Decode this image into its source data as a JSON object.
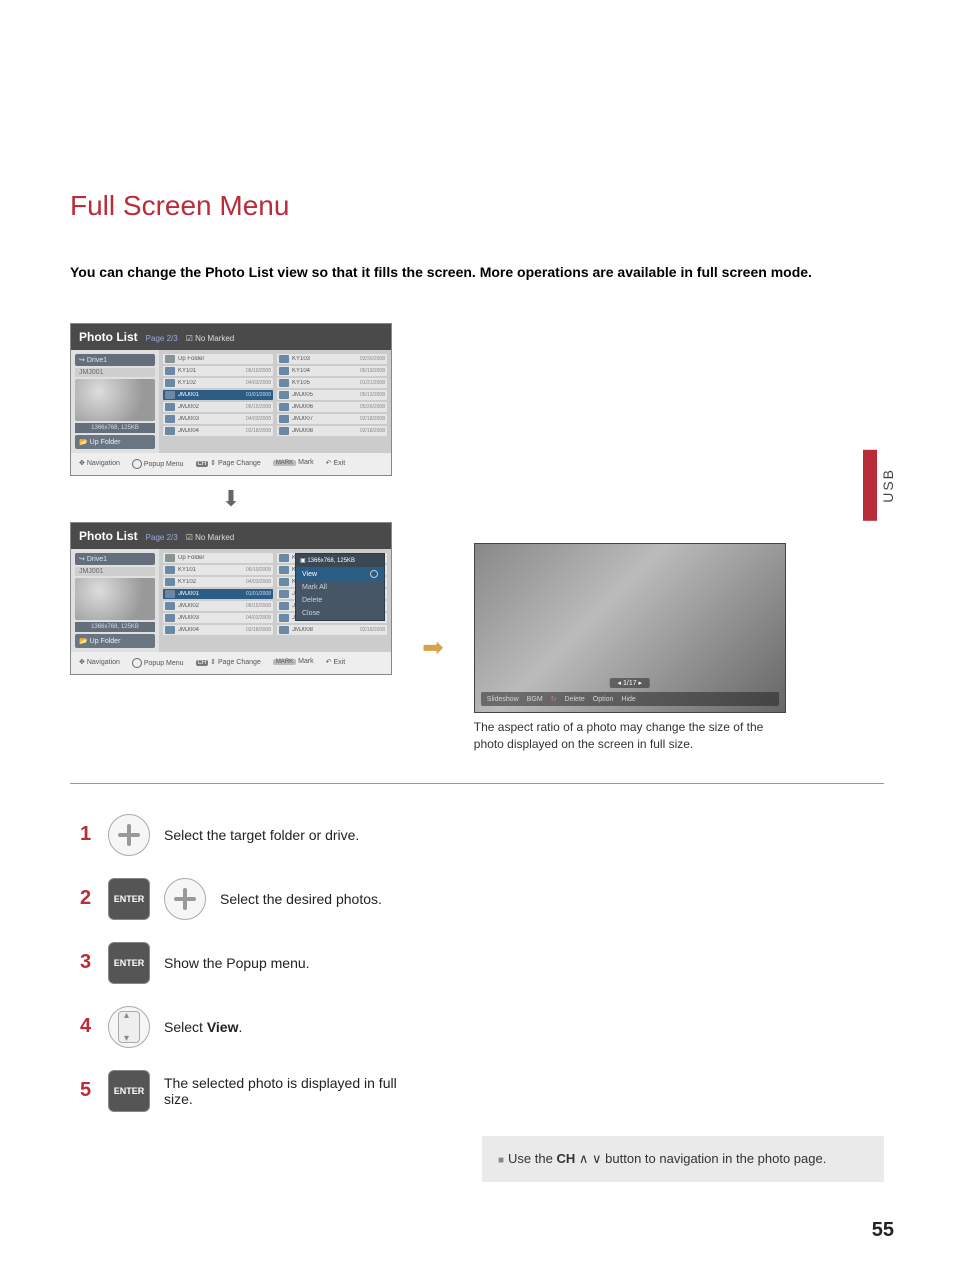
{
  "page": {
    "title": "Full Screen Menu",
    "intro": "You can change the Photo List view so that it fills the screen. More operations are available in full screen mode.",
    "side_tab": "USB",
    "page_number": "55"
  },
  "screen1": {
    "header_title": "Photo List",
    "header_page": "Page 2/3",
    "header_marked": "No Marked",
    "drive": "Drive1",
    "selected_name": "JMJ001",
    "selected_size": "1366x768, 125KB",
    "up_folder": "Up Folder",
    "col1": [
      {
        "name": "Up Folder",
        "date": "",
        "folder": true
      },
      {
        "name": "KY101",
        "date": "06/10/2008"
      },
      {
        "name": "KY102",
        "date": "04/03/2008"
      },
      {
        "name": "JMJ001",
        "date": "01/01/2008",
        "sel": true
      },
      {
        "name": "JMJ002",
        "date": "06/15/2008"
      },
      {
        "name": "JMJ003",
        "date": "04/03/2008"
      },
      {
        "name": "JMJ004",
        "date": "02/18/2008"
      }
    ],
    "col2": [
      {
        "name": "KY103",
        "date": "03/30/2008"
      },
      {
        "name": "KY104",
        "date": "06/19/2008"
      },
      {
        "name": "KY105",
        "date": "01/31/2008"
      },
      {
        "name": "JMJ005",
        "date": "05/13/2008"
      },
      {
        "name": "JMJ006",
        "date": "05/26/2008"
      },
      {
        "name": "JMJ007",
        "date": "02/18/2008"
      },
      {
        "name": "JMJ008",
        "date": "02/18/2008"
      }
    ],
    "footer": {
      "nav": "Navigation",
      "popup": "Popup Menu",
      "ch": "CH",
      "page": "Page Change",
      "markbtn": "MARK",
      "mark": "Mark",
      "exit": "Exit"
    }
  },
  "screen2": {
    "popup": {
      "head": "1366x768, 125KB",
      "view": "View",
      "mark_all": "Mark All",
      "delete": "Delete",
      "close": "Close"
    }
  },
  "fullview": {
    "page": "1/17",
    "bar": [
      "Slideshow",
      "BGM",
      "Delete",
      "Option",
      "Hide"
    ],
    "caption": "The aspect ratio of a photo may change the size of the photo displayed on the screen in full size."
  },
  "steps": {
    "s1": "Select the target folder or drive.",
    "s2": "Select the desired photos.",
    "s3": "Show the Popup menu.",
    "s4_pre": "Select ",
    "s4_view": "View",
    "s4_post": ".",
    "s5": "The selected photo is displayed in full size.",
    "enter": "ENTER"
  },
  "tip": {
    "pre": "Use the ",
    "ch": "CH",
    "post": " button to navigation in the photo page."
  }
}
